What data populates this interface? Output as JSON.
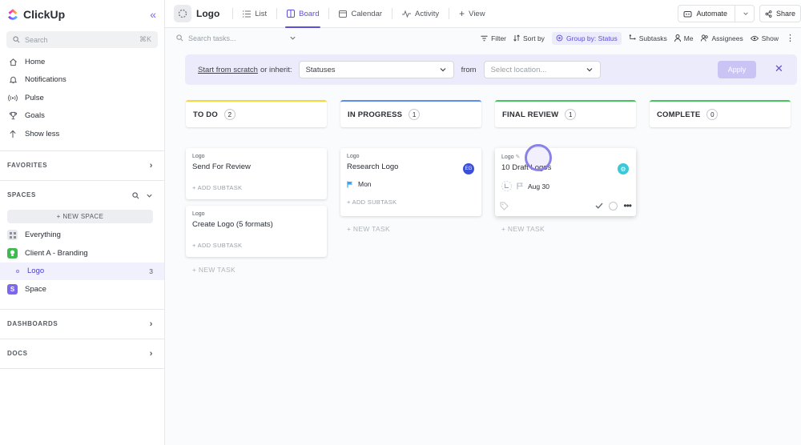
{
  "app": {
    "name": "ClickUp"
  },
  "sidebar": {
    "search_placeholder": "Search",
    "search_shortcut": "⌘K",
    "nav": [
      {
        "label": "Home"
      },
      {
        "label": "Notifications"
      },
      {
        "label": "Pulse"
      },
      {
        "label": "Goals"
      },
      {
        "label": "Show less"
      }
    ],
    "favorites_label": "FAVORITES",
    "spaces_label": "SPACES",
    "new_space_label": "+ NEW SPACE",
    "spaces": [
      {
        "label": "Everything"
      },
      {
        "label": "Client A - Branding",
        "color": "#3fb950"
      },
      {
        "label": "Logo",
        "count": "3"
      },
      {
        "label": "Space",
        "initial": "S",
        "color": "#7b68ee"
      }
    ],
    "dashboards_label": "DASHBOARDS",
    "docs_label": "DOCS"
  },
  "topbar": {
    "title": "Logo",
    "tabs": [
      {
        "label": "List"
      },
      {
        "label": "Board"
      },
      {
        "label": "Calendar"
      },
      {
        "label": "Activity"
      },
      {
        "label": "View"
      }
    ],
    "automate_label": "Automate",
    "share_label": "Share"
  },
  "toolbar": {
    "search_placeholder": "Search tasks...",
    "filter_label": "Filter",
    "sort_label": "Sort by",
    "group_label": "Group by: Status",
    "subtasks_label": "Subtasks",
    "me_label": "Me",
    "assignees_label": "Assignees",
    "show_label": "Show"
  },
  "banner": {
    "start_label": "Start from scratch",
    "inherit_label": "or inherit:",
    "statuses_value": "Statuses",
    "from_label": "from",
    "location_placeholder": "Select location...",
    "apply_label": "Apply"
  },
  "board": {
    "columns": [
      {
        "name": "TO DO",
        "count": "2",
        "color": "#f5d63d"
      },
      {
        "name": "IN PROGRESS",
        "count": "1",
        "color": "#5b8def"
      },
      {
        "name": "FINAL REVIEW",
        "count": "1",
        "color": "#46c35f"
      },
      {
        "name": "COMPLETE",
        "count": "0",
        "color": "#46c35f"
      }
    ],
    "cards": {
      "send_for_review": {
        "crumb": "Logo",
        "name": "Send For Review",
        "add_subtask": "+ ADD SUBTASK"
      },
      "create_logo": {
        "crumb": "Logo",
        "name": "Create Logo (5 formats)",
        "add_subtask": "+ ADD SUBTASK"
      },
      "research_logo": {
        "crumb": "Logo",
        "name": "Research Logo",
        "avatar": "EG",
        "due": "Mon",
        "add_subtask": "+ ADD SUBTASK"
      },
      "draft_logos": {
        "crumb": "Logo",
        "name": "10 Draft Logos",
        "due": "Aug 30"
      }
    },
    "new_task_label": "+ NEW TASK"
  }
}
